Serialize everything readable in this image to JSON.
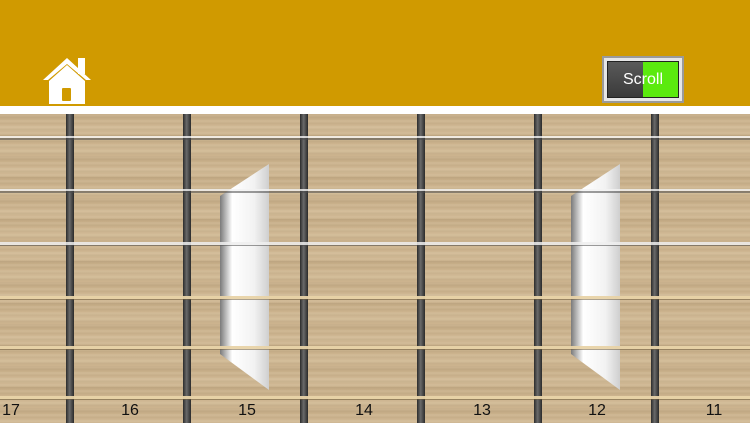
{
  "app": {
    "header_color": "#D09A00",
    "home_icon": "home-icon",
    "scroll_toggle": {
      "label": "Scroll",
      "state": "on",
      "on_color": "#5BEA0E"
    }
  },
  "fretboard": {
    "fret_numbers": [
      "17",
      "16",
      "15",
      "14",
      "13",
      "12",
      "11"
    ],
    "inlay_frets": [
      "15",
      "12"
    ],
    "string_count": 6
  }
}
